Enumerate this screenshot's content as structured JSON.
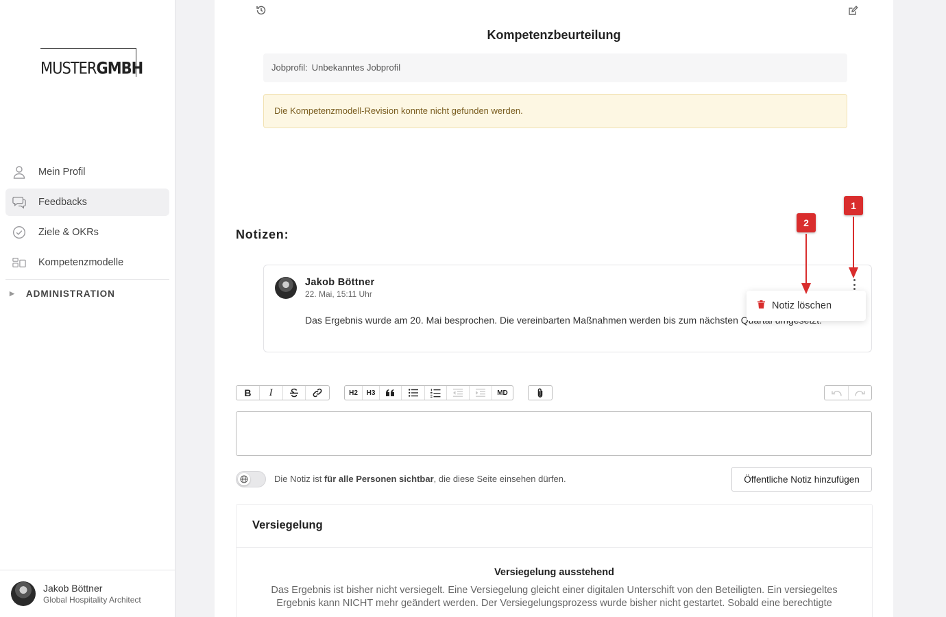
{
  "brand": {
    "logo_part1": "MUSTER",
    "logo_part2": "GMBH"
  },
  "sidebar": {
    "items": [
      {
        "label": "Mein Profil",
        "icon": "person-icon"
      },
      {
        "label": "Feedbacks",
        "icon": "chat-bubbles-icon"
      },
      {
        "label": "Ziele & OKRs",
        "icon": "check-circle-icon"
      },
      {
        "label": "Kompetenzmodelle",
        "icon": "grid-icon"
      }
    ],
    "admin_label": "ADMINISTRATION",
    "user": {
      "name": "Jakob Böttner",
      "role": "Global Hospitality Architect"
    }
  },
  "page": {
    "title": "Kompetenzbeurteilung",
    "jobprofil_label": "Jobprofil:",
    "jobprofil_value": "Unbekanntes Jobprofil",
    "warning": "Die Kompetenzmodell-Revision konnte nicht gefunden werden."
  },
  "notes": {
    "heading": "Notizen:",
    "items": [
      {
        "author": "Jakob Böttner",
        "date": "22. Mai, 15:11 Uhr",
        "text": "Das Ergebnis wurde am 20. Mai besprochen. Die vereinbarten Maßnahmen werden bis zum nächsten Quartal umgesetzt."
      }
    ],
    "menu": {
      "delete_label": "Notiz löschen"
    }
  },
  "toolbar": {
    "h2": "H2",
    "h3": "H3",
    "md": "MD"
  },
  "visibility": {
    "prefix": "Die Notiz ist ",
    "bold": "für alle Personen sichtbar",
    "suffix": ", die diese Seite einsehen dürfen.",
    "button": "Öffentliche Notiz hinzufügen"
  },
  "seal": {
    "heading": "Versiegelung",
    "status_title": "Versiegelung ausstehend",
    "text": "Das Ergebnis ist bisher nicht versiegelt. Eine Versiegelung gleicht einer digitalen Unterschift von den Beteiligten. Ein versiegeltes Ergebnis kann NICHT mehr geändert werden. Der Versiegelungsprozess wurde bisher nicht gestartet. Sobald eine berechtigte"
  },
  "annotations": {
    "badge1": "1",
    "badge2": "2",
    "color": "#d92d2d"
  },
  "colors": {
    "accent_warning_bg": "#fdf7e3",
    "warning_text": "#7a5d1f",
    "delete_icon": "#d92d2d"
  }
}
